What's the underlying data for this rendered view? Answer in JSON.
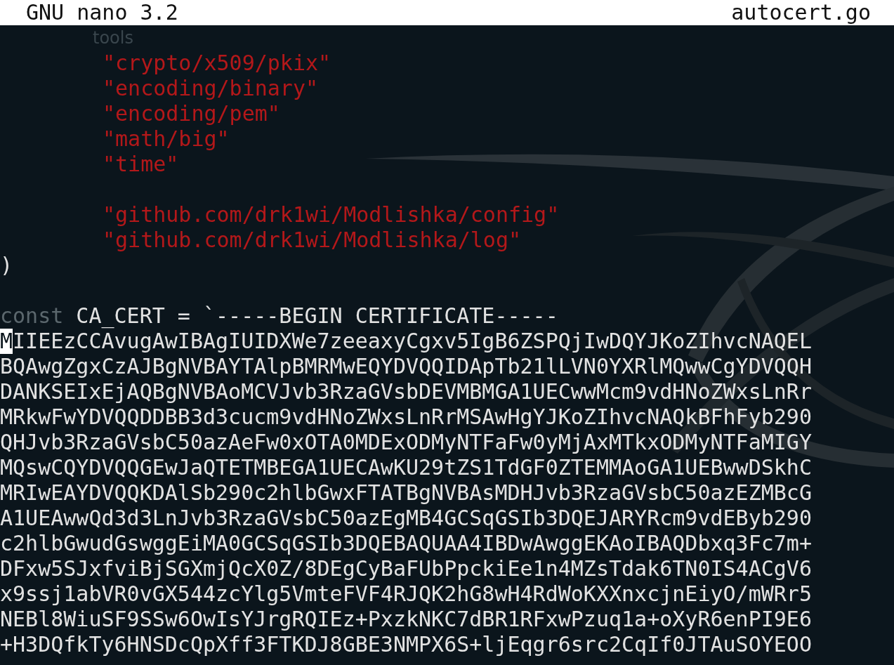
{
  "title_bar": {
    "app": "GNU nano 3.2",
    "file": "autocert.go"
  },
  "lines": [
    {
      "segments": [
        {
          "text": "tools",
          "kind": "overlay"
        }
      ]
    },
    {
      "indented": true,
      "segments": [
        {
          "text": "\"crypto/x509/pkix\"",
          "kind": "string"
        }
      ]
    },
    {
      "indented": true,
      "segments": [
        {
          "text": "\"encoding/binary\"",
          "kind": "string"
        }
      ]
    },
    {
      "indented": true,
      "segments": [
        {
          "text": "\"encoding/pem\"",
          "kind": "string"
        }
      ]
    },
    {
      "indented": true,
      "segments": [
        {
          "text": "\"math/big\"",
          "kind": "string"
        }
      ]
    },
    {
      "indented": true,
      "segments": [
        {
          "text": "\"time\"",
          "kind": "string"
        }
      ]
    },
    {
      "blank_before": true,
      "indented": true,
      "segments": [
        {
          "text": "\"github.com/drk1wi/Modlishka/config\"",
          "kind": "string"
        }
      ]
    },
    {
      "indented": true,
      "segments": [
        {
          "text": "\"github.com/drk1wi/Modlishka/log\"",
          "kind": "string"
        }
      ]
    },
    {
      "segments": [
        {
          "text": ")",
          "kind": "plain"
        }
      ]
    },
    {
      "blank_before": true,
      "segments": [
        {
          "text": "const",
          "kind": "keyword"
        },
        {
          "text": " CA_CERT = `-----BEGIN CERTIFICATE-----",
          "kind": "plain"
        }
      ]
    },
    {
      "segments": [
        {
          "text": "M",
          "kind": "cursor"
        },
        {
          "text": "IIEEzCCAvugAwIBAgIUIDXWe7zeeaxyCgxv5IgB6ZSPQjIwDQYJKoZIhvcNAQEL",
          "kind": "plain"
        }
      ]
    },
    {
      "segments": [
        {
          "text": "BQAwgZgxCzAJBgNVBAYTAlpBMRMwEQYDVQQIDApTb21lLVN0YXRlMQwwCgYDVQQH",
          "kind": "plain"
        }
      ]
    },
    {
      "segments": [
        {
          "text": "DANKSEIxEjAQBgNVBAoMCVJvb3RzaGVsbDEVMBMGA1UECwwMcm9vdHNoZWxsLnRr",
          "kind": "plain"
        }
      ]
    },
    {
      "segments": [
        {
          "text": "MRkwFwYDVQQDDBB3d3cucm9vdHNoZWxsLnRrMSAwHgYJKoZIhvcNAQkBFhFyb290",
          "kind": "plain"
        }
      ]
    },
    {
      "segments": [
        {
          "text": "QHJvb3RzaGVsbC50azAeFw0xOTA0MDExODMyNTFaFw0yMjAxMTkxODMyNTFaMIGY",
          "kind": "plain"
        }
      ]
    },
    {
      "segments": [
        {
          "text": "MQswCQYDVQQGEwJaQTETMBEGA1UECAwKU29tZS1TdGF0ZTEMMAoGA1UEBwwDSkhC",
          "kind": "plain"
        }
      ]
    },
    {
      "segments": [
        {
          "text": "MRIwEAYDVQQKDAlSb290c2hlbGwxFTATBgNVBAsMDHJvb3RzaGVsbC50azEZMBcG",
          "kind": "plain"
        }
      ]
    },
    {
      "segments": [
        {
          "text": "A1UEAwwQd3d3LnJvb3RzaGVsbC50azEgMB4GCSqGSIb3DQEJARYRcm9vdEByb290",
          "kind": "plain"
        }
      ]
    },
    {
      "segments": [
        {
          "text": "c2hlbGwudGswggEiMA0GCSqGSIb3DQEBAQUAA4IBDwAwggEKAoIBAQDbxq3Fc7m+",
          "kind": "plain"
        }
      ]
    },
    {
      "segments": [
        {
          "text": "DFxw5SJxfviBjSGXmjQcX0Z/8DEgCyBaFUbPpckiEe1n4MZsTdak6TN0IS4ACgV6",
          "kind": "plain"
        }
      ]
    },
    {
      "segments": [
        {
          "text": "x9ssj1abVR0vGX544zcYlg5VmteFVF4RJQK2hG8wH4RdWoKXXnxcjnEiyO/mWRr5",
          "kind": "plain"
        }
      ]
    },
    {
      "segments": [
        {
          "text": "NEBl8WiuSF9SSw6OwIsYJrgRQIEz+PxzkNKC7dBR1RFxwPzuq1a+oXyR6enPI9E6",
          "kind": "plain"
        }
      ]
    },
    {
      "segments": [
        {
          "text": "+H3DQfkTy6HNSDcQpXff3FTKDJ8GBE3NMPX6S+ljEqgr6src2CqIf0JTAuSOYEOO",
          "kind": "plain"
        }
      ]
    }
  ]
}
